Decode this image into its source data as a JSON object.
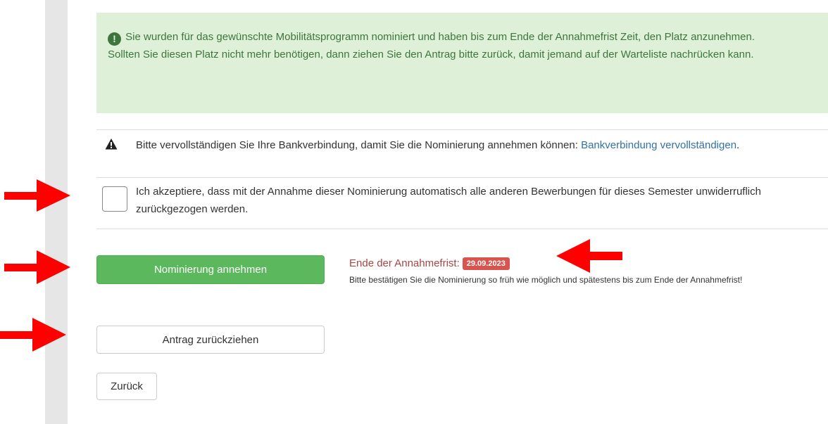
{
  "alert": {
    "icon": "exclamation-circle-icon",
    "icon_glyph": "!",
    "line1": "Sie wurden für das gewünschte Mobilitätsprogramm nominiert und haben bis zum Ende der Annahmefrist Zeit, den Platz anzunehmen.",
    "line2": "Sollten Sie diesen Platz nicht mehr benötigen, dann ziehen Sie den Antrag bitte zurück, damit jemand auf der Warteliste nachrücken kann."
  },
  "warning": {
    "icon": "warning-triangle-icon",
    "text": "Bitte vervollständigen Sie Ihre Bankverbindung, damit Sie die Nominierung annehmen können: ",
    "link": "Bankverbindung vervollständigen",
    "suffix": "."
  },
  "consent": {
    "checked": false,
    "text": "Ich akzeptiere, dass mit der Annahme dieser Nominierung automatisch alle anderen Bewerbungen für dieses Semester unwiderruflich zurückgezogen werden."
  },
  "buttons": {
    "accept": "Nominierung annehmen",
    "withdraw": "Antrag zurückziehen",
    "back": "Zurück"
  },
  "deadline": {
    "label": "Ende der Annahmefrist:",
    "date": "29.09.2023",
    "note": "Bitte bestätigen Sie die Nominierung so früh wie möglich und spätestens bis zum Ende der Annahmefrist!"
  },
  "colors": {
    "success_bg": "#dff0d8",
    "success_text": "#3c763d",
    "accept_button": "#5cb85c",
    "deadline_text": "#a94442",
    "badge": "#d9534f",
    "link": "#3071a9",
    "annotation_arrow": "#ff0000"
  }
}
